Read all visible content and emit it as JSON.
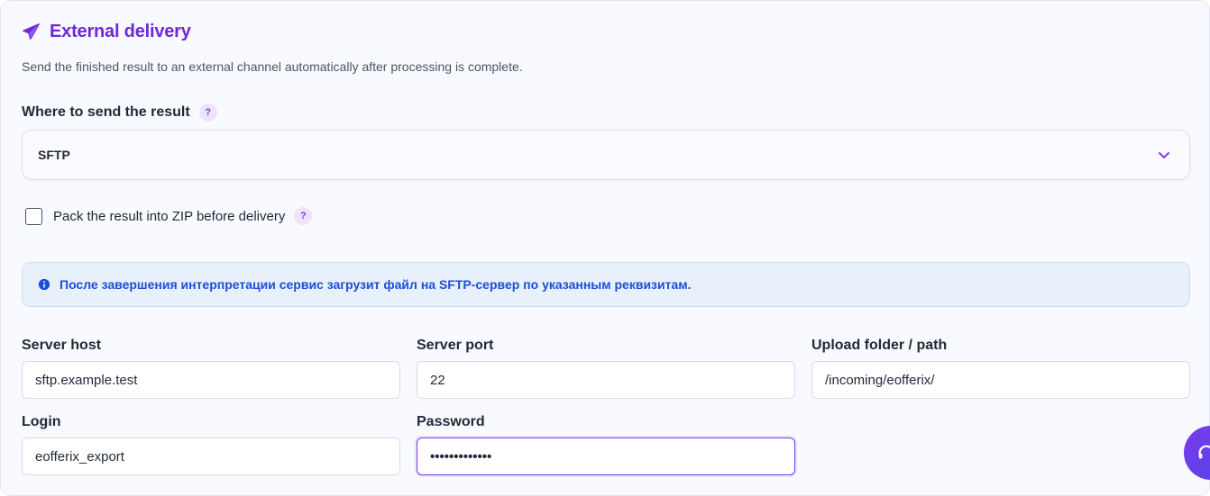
{
  "section": {
    "title": "External delivery",
    "description": "Send the finished result to an external channel automatically after processing is complete.",
    "icon": "paper-plane-icon"
  },
  "destination": {
    "label": "Where to send the result",
    "help": "?",
    "selected": "SFTP"
  },
  "zip": {
    "label": "Pack the result into ZIP before delivery",
    "checked": false,
    "help": "?"
  },
  "notice": {
    "text": "После завершения интерпретации сервис загрузит файл на SFTP-сервер по указанным реквизитам."
  },
  "fields": {
    "host": {
      "label": "Server host",
      "value": "sftp.example.test"
    },
    "port": {
      "label": "Server port",
      "value": "22"
    },
    "path": {
      "label": "Upload folder / path",
      "value": "/incoming/eofferix/"
    },
    "login": {
      "label": "Login",
      "value": "eofferix_export"
    },
    "password": {
      "label": "Password",
      "value": "•••••••••••••"
    }
  },
  "colors": {
    "accent": "#6d28d9",
    "info_text": "#1d4ed8",
    "info_bg": "#e8f0fc"
  }
}
